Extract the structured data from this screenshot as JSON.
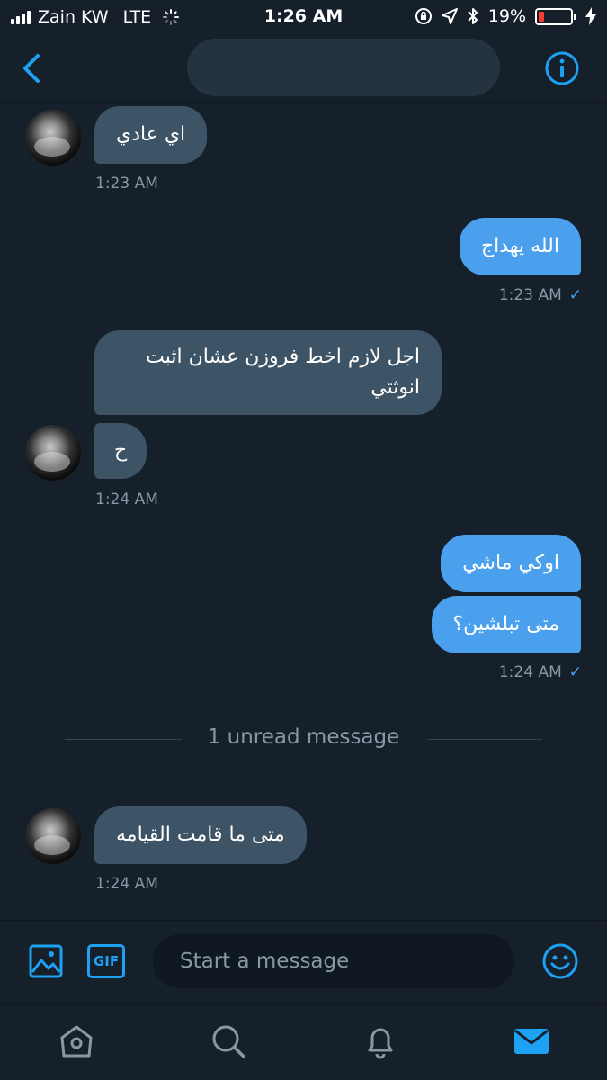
{
  "status_bar": {
    "carrier": "Zain KW",
    "network": "LTE",
    "time": "1:26 AM",
    "battery": "19%",
    "battery_level": 0.19
  },
  "header": {
    "back_icon": "chevron-left-icon",
    "info_icon": "info-icon"
  },
  "messages": [
    {
      "direction": "in",
      "text": "اي عادي"
    },
    {
      "direction": "in",
      "time": "1:23 AM"
    },
    {
      "direction": "out",
      "text": "الله يهداج"
    },
    {
      "direction": "out",
      "time": "1:23 AM"
    },
    {
      "direction": "in",
      "text": "اجل لازم اخط فروزن عشان اثبت"
    },
    {
      "direction": "in",
      "text": "انوثتي"
    },
    {
      "direction": "in",
      "text": "ح"
    },
    {
      "direction": "in",
      "time": "1:24 AM"
    },
    {
      "direction": "out",
      "text": "اوكي ماشي"
    },
    {
      "direction": "out",
      "text": "متى تبلشين؟"
    },
    {
      "direction": "out",
      "time": "1:24 AM"
    },
    {
      "direction": "in",
      "text": "متى ما قامت القيامه"
    },
    {
      "direction": "in",
      "time": "1:24 AM"
    }
  ],
  "unread_label": "1 unread message",
  "composer": {
    "placeholder": "Start a message",
    "gif_label": "GIF"
  },
  "tabs": [
    "home-icon",
    "search-icon",
    "notifications-icon",
    "messages-icon"
  ],
  "colors": {
    "background": "#15202b",
    "incoming_bubble": "#3d5466",
    "outgoing_bubble": "#4aa0ec",
    "accent": "#1da1f2",
    "muted_text": "#8899a6"
  }
}
